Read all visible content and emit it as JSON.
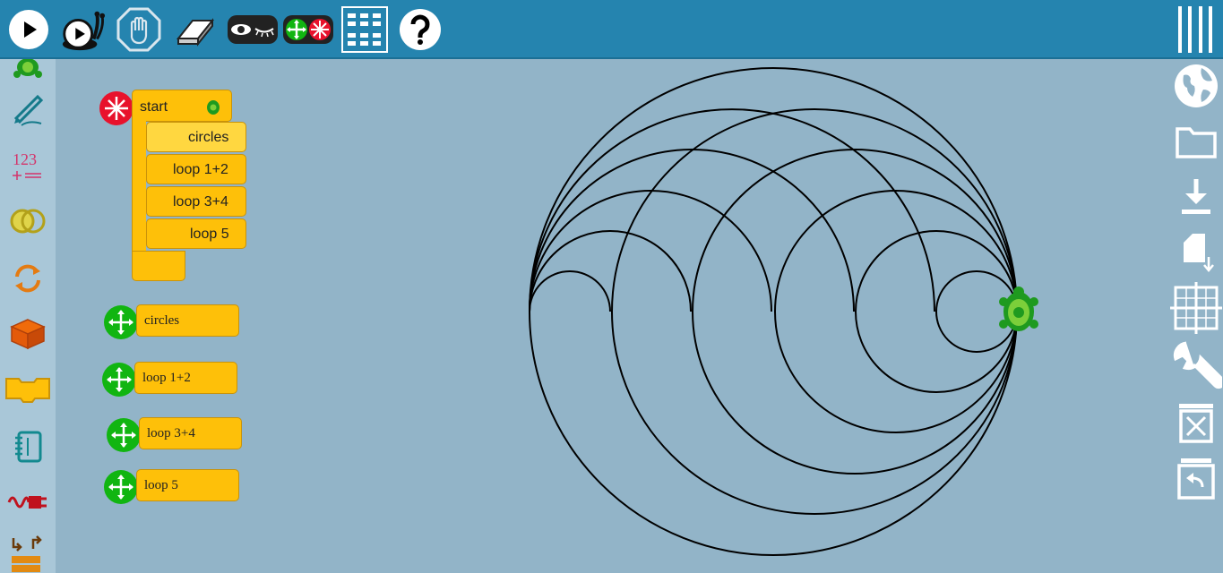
{
  "toolbar": {
    "buttons": [
      {
        "name": "run-button",
        "icon": "play-icon"
      },
      {
        "name": "run-slow-button",
        "icon": "snail-icon"
      },
      {
        "name": "stop-button",
        "icon": "stop-hand-icon"
      },
      {
        "name": "clear-button",
        "icon": "eraser-icon"
      },
      {
        "name": "hide-blocks-button",
        "icon": "eye-icon"
      },
      {
        "name": "collapse-blocks-button",
        "icon": "collapse-icon"
      },
      {
        "name": "grid-menu-button",
        "icon": "grid-icon"
      },
      {
        "name": "help-button",
        "icon": "question-icon"
      }
    ],
    "menu_icon": "hamburger-icon"
  },
  "palette": {
    "items": [
      "turtle",
      "pen",
      "number",
      "boolean",
      "flow",
      "action",
      "boxes",
      "media",
      "extras",
      "sensors",
      "heap"
    ]
  },
  "aux_toolbar": {
    "items": [
      "globe-icon",
      "folder-icon",
      "download-icon",
      "save-icon",
      "grid-crosshair-icon",
      "wrench-icon",
      "trash-icon",
      "restore-icon"
    ]
  },
  "blocks": {
    "start": {
      "label": "start"
    },
    "start_contents": [
      "circles",
      "loop 1+2",
      "loop 3+4",
      "loop 5"
    ],
    "actions": [
      "circles",
      "loop 1+2",
      "loop 3+4",
      "loop 5"
    ]
  },
  "colors": {
    "toolbar": "#2584af",
    "canvas": "#92b4c8",
    "block": "#fec009",
    "turtle": "#1f9a1f",
    "start_icon": "#e8122c",
    "action_icon": "#11b511"
  }
}
